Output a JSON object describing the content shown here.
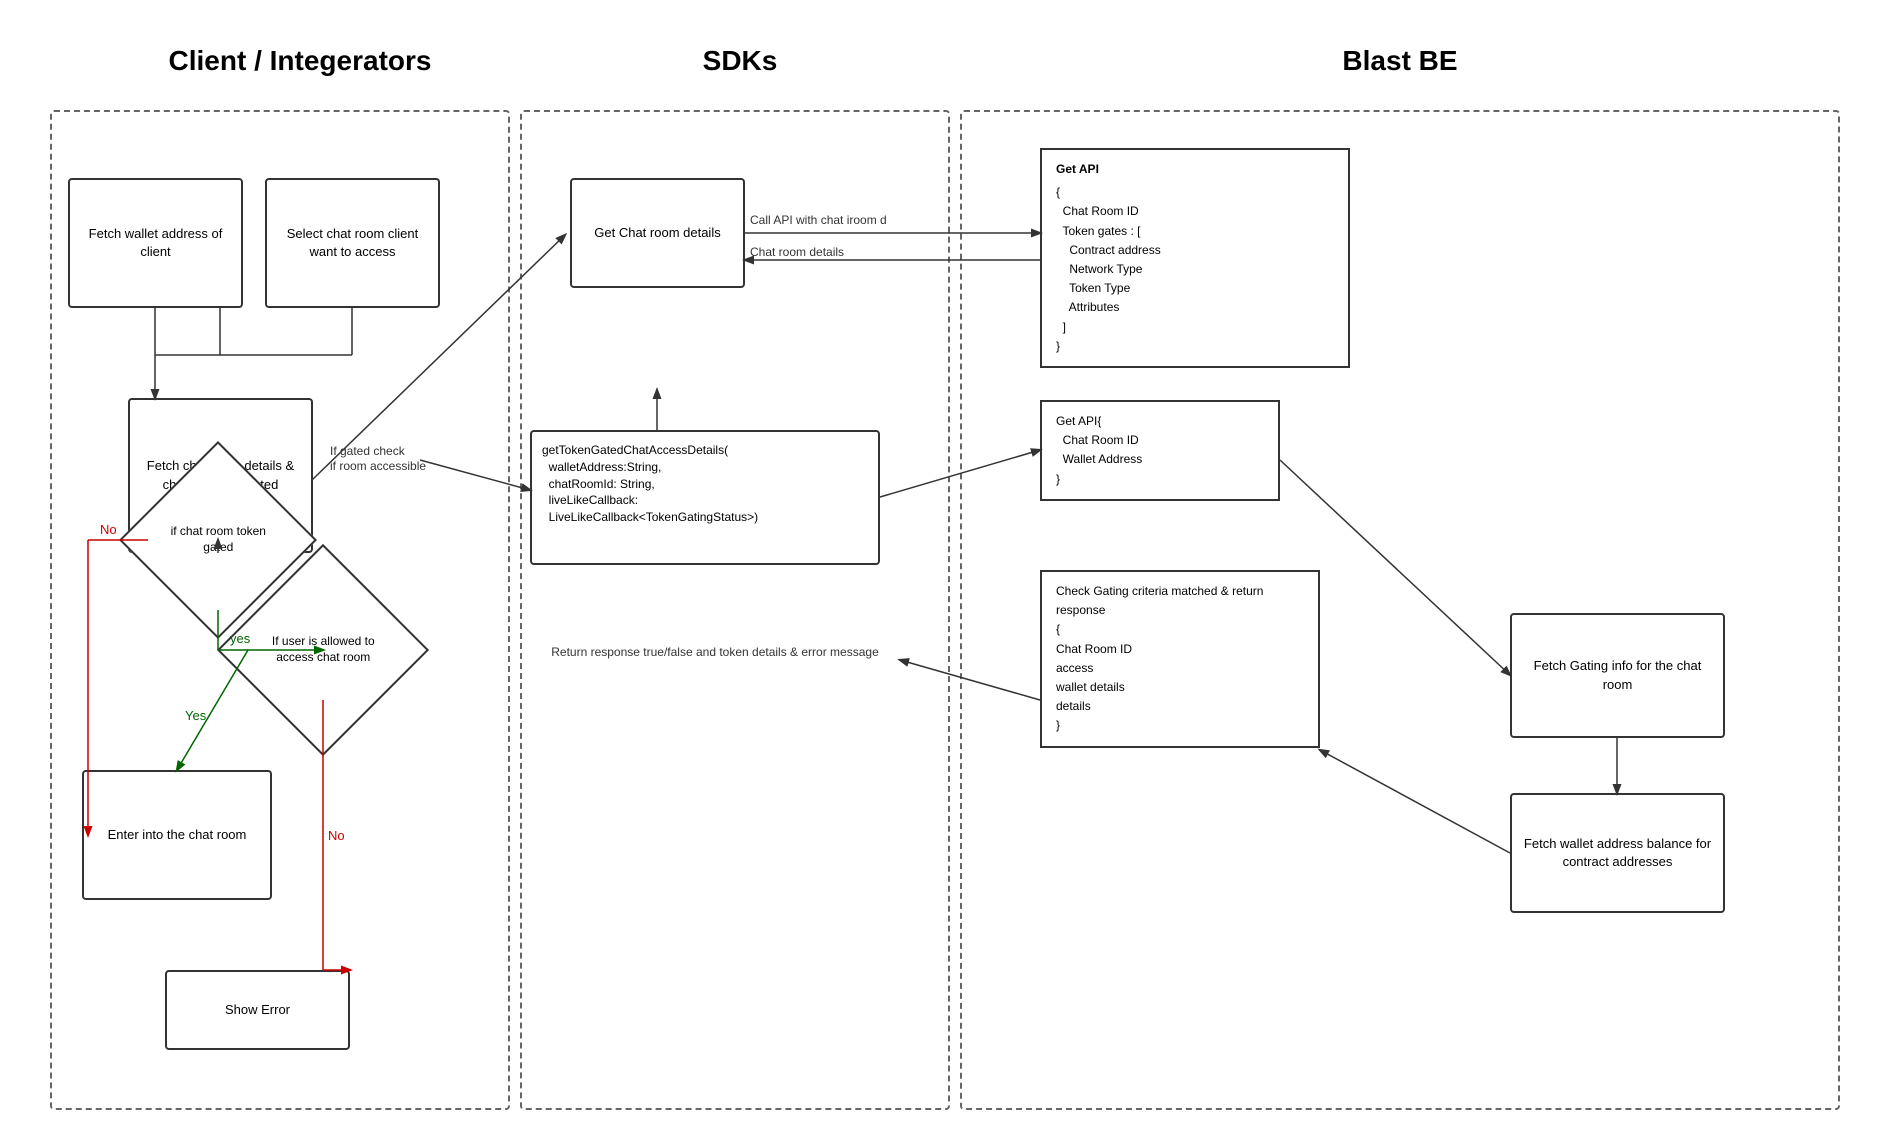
{
  "titles": {
    "col1": "Client / Integerators",
    "col2": "SDKs",
    "col3": "Blast BE"
  },
  "boxes": {
    "fetch_wallet": "Fetch wallet address of client",
    "select_chat": "Select chat room client want to access",
    "fetch_chat_details": "Fetch chat room details & check if token gated",
    "diamond_token_gated": "if chat room token gated",
    "diamond_user_allowed": "If user is allowed to access chat room",
    "enter_chat": "Enter into the chat room",
    "show_error": "Show Error",
    "get_chat_room_sdk": "Get Chat room details",
    "get_token_gated_sdk": "getTokenGatedChatAccessDetails(\n  walletAddress:String,\n  chatRoomId: String,\n  liveLikeCallback:\n  LiveLikeCallback<TokenGatingStatus>)",
    "return_response": "Return response true/false and token details\n& error message",
    "get_api_1_title": "Get API",
    "get_api_1_body": "{\n  Chat Room ID\n  Token gates : [\n    Contract address\n    Network Type\n    Token Type\n    Attributes\n  ]\n}",
    "get_api_2_body": "Get API{\n  Chat Room ID\n  Wallet Address\n}",
    "fetch_gating_info": "Fetch Gating info for the chat room",
    "fetch_wallet_balance": "Fetch wallet address balance for contract addresses",
    "check_gating": "Check Gating criteria matched & return response\n{\n  Chat Room ID\n  access\n  wallet details\n  details\n}"
  },
  "labels": {
    "call_api": "Call API with chat iroom d",
    "chat_room_details": "Chat room details",
    "if_gated": "If gated check if room accessible",
    "yes_token": "yes",
    "no_token": "No",
    "yes_user": "Yes",
    "no_user": "No"
  },
  "colors": {
    "arrow_default": "#333333",
    "arrow_red": "#cc0000",
    "arrow_green": "#006600"
  }
}
